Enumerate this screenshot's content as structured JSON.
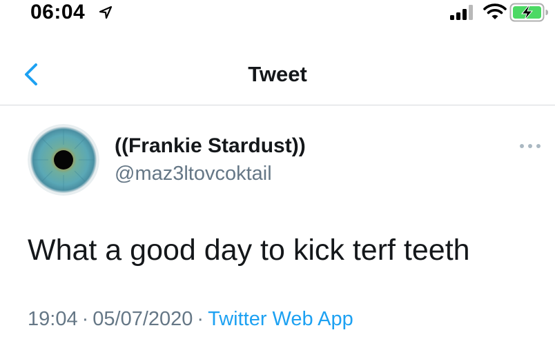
{
  "status_bar": {
    "time": "06:04",
    "icons": [
      "location-arrow-icon",
      "cellular-signal-icon",
      "wifi-icon",
      "battery-charging-icon"
    ],
    "battery_color": "#4cd964"
  },
  "nav": {
    "back_icon": "chevron-left-icon",
    "title": "Tweet",
    "accent_color": "#1da1f2"
  },
  "tweet": {
    "display_name": "((Frankie Stardust))",
    "handle": "@maz3ltovcoktail",
    "more_icon": "more-horizontal-icon",
    "text": "What a good day to kick terf teeth",
    "time": "19:04",
    "date": "05/07/2020",
    "separator": "·",
    "source": "Twitter Web App"
  }
}
